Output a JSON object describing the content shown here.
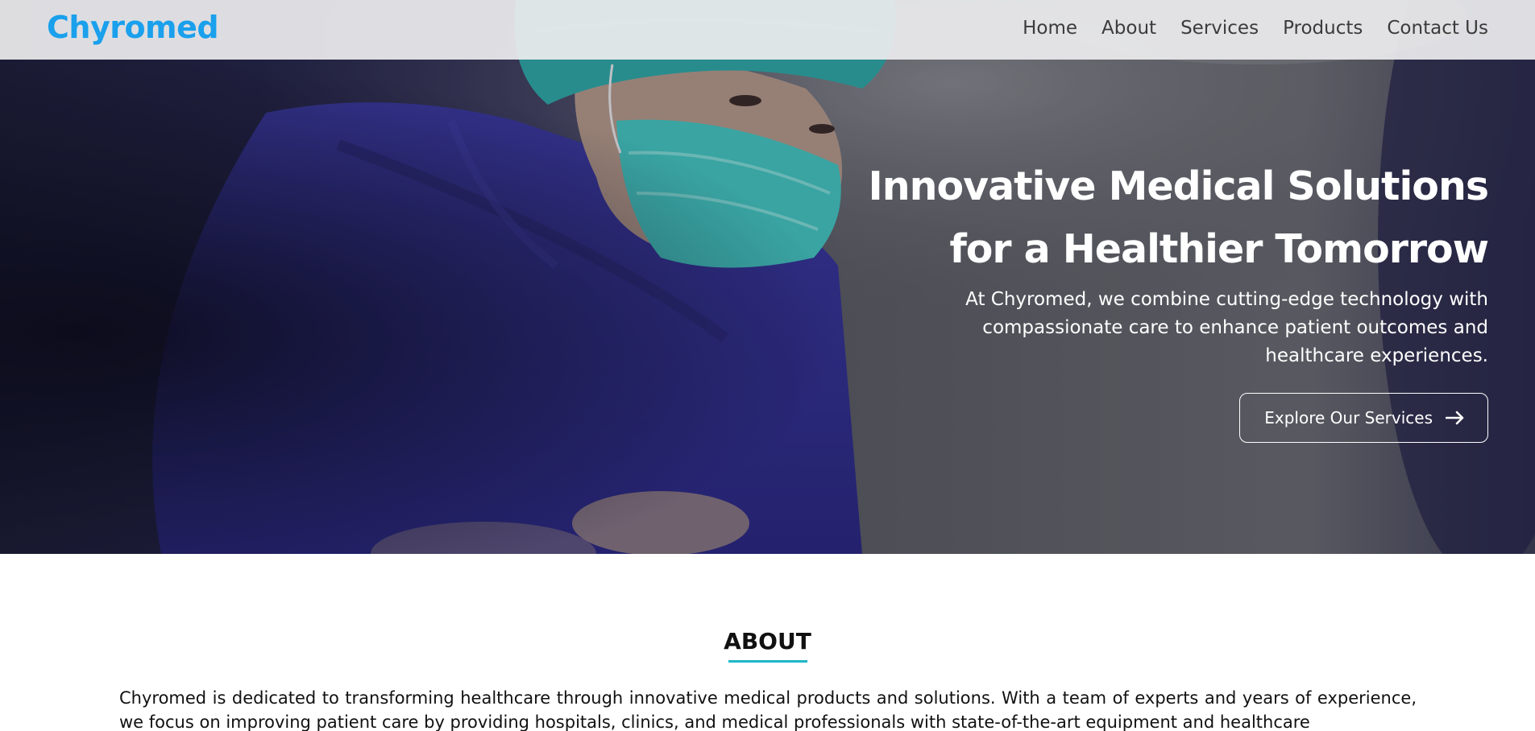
{
  "brand": {
    "name": "Chyromed",
    "color": "#1aa0ec"
  },
  "nav": {
    "items": [
      {
        "label": "Home"
      },
      {
        "label": "About"
      },
      {
        "label": "Services"
      },
      {
        "label": "Products"
      },
      {
        "label": "Contact Us"
      }
    ]
  },
  "hero": {
    "title_line1": "Innovative Medical Solutions",
    "title_line2": "for a Healthier Tomorrow",
    "subtitle": "At Chyromed, we combine cutting-edge technology with compassionate care to enhance patient outcomes and healthcare experiences.",
    "cta_label": "Explore Our Services",
    "cta_icon": "arrow-right-icon"
  },
  "about": {
    "title": "ABOUT",
    "accent_color": "#1fb6c9",
    "body": "Chyromed is dedicated to transforming healthcare through innovative medical products and solutions. With a team of experts and years of experience, we focus on improving patient care by providing hospitals, clinics, and medical professionals with state-of-the-art equipment and healthcare"
  }
}
